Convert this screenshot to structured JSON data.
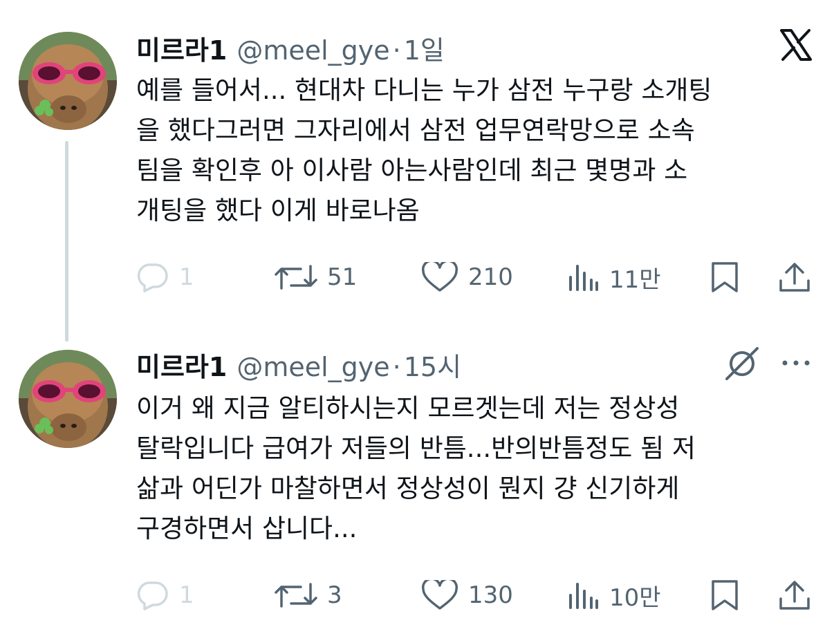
{
  "tweets": [
    {
      "name": "미르라1",
      "handle": "@meel_gye",
      "separator": "·",
      "time": "1일",
      "text": "예를 들어서... 현대차 다니는 누가 삼전 누구랑 소개팅\n을 했다그러면 그자리에서 삼전 업무연락망으로 소속\n팀을 확인후 아 이사람 아는사람인데 최근 몇명과 소\n개팅을 했다 이게 바로나옴",
      "reply_count": "1",
      "retweet_count": "51",
      "like_count": "210",
      "view_count": "11만"
    },
    {
      "name": "미르라1",
      "handle": "@meel_gye",
      "separator": "·",
      "time": "15시",
      "text": "이거 왜 지금 알티하시는지 모르겟는데 저는 정상성\n탈락입니다 급여가 저들의 반틈...반의반틈정도 됨 저\n삶과 어딘가 마찰하면서 정상성이 뭔지 걍 신기하게\n구경하면서 삽니다...",
      "reply_count": "1",
      "retweet_count": "3",
      "like_count": "130",
      "view_count": "10만"
    }
  ],
  "icons": {
    "brand": "x-logo-icon",
    "reply": "reply-icon",
    "retweet": "retweet-icon",
    "like": "heart-icon",
    "views": "views-icon",
    "bookmark": "bookmark-icon",
    "share": "share-icon",
    "grok": "grok-icon",
    "more": "more-icon"
  },
  "colors": {
    "text": "#0f1419",
    "secondary": "#536471",
    "disabled": "#cfd9de",
    "sunglasses": "#e0447a"
  }
}
